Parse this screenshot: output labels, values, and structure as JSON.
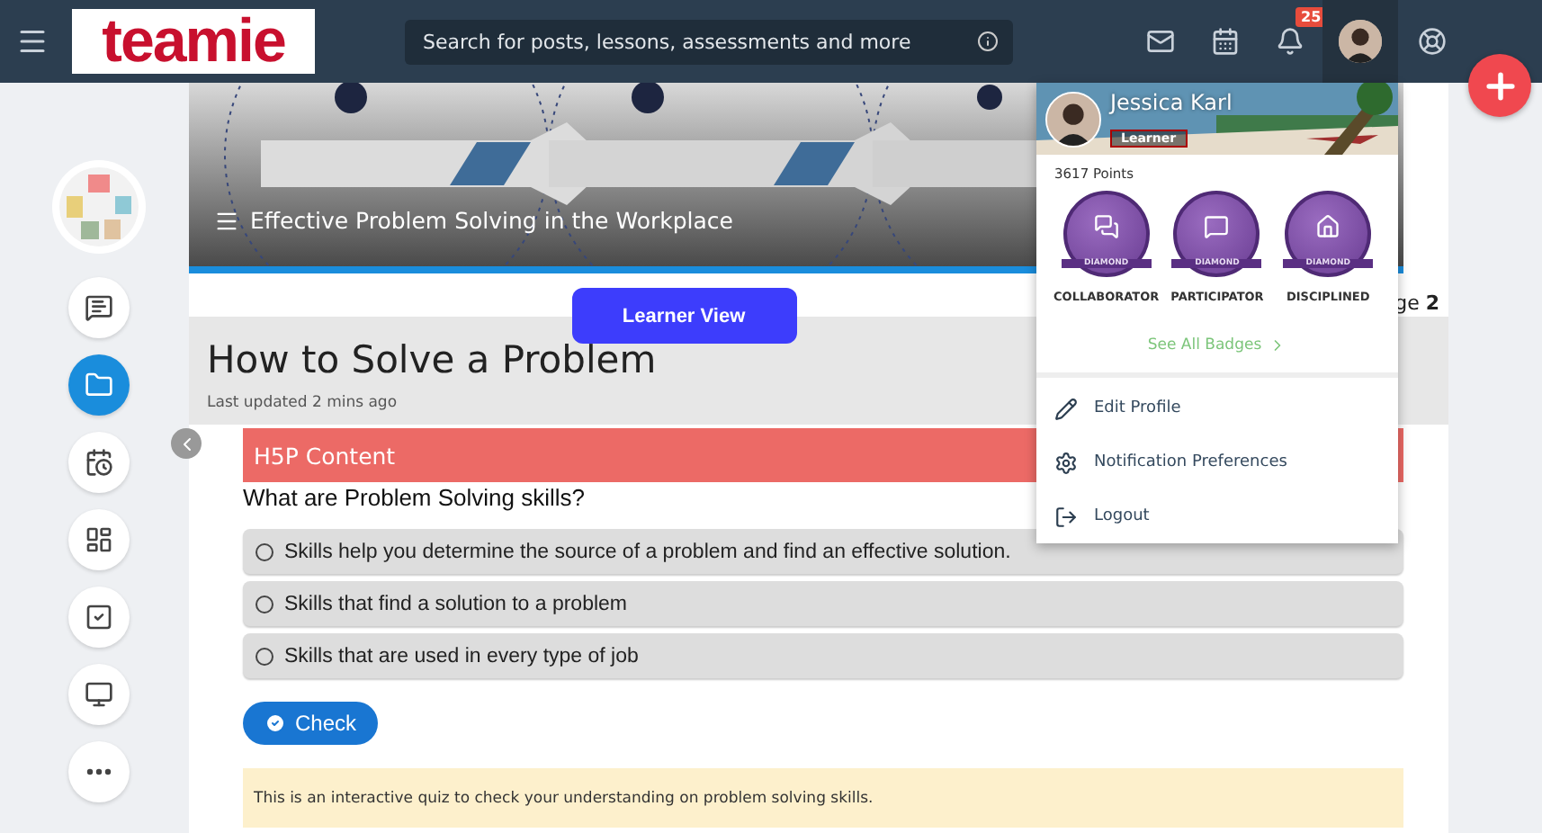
{
  "top_bar": {
    "logo": "teamie",
    "search": {
      "placeholder": "Search for posts, lessons, assessments and more"
    },
    "notification_count": "25"
  },
  "sidebar": {
    "items": [
      {
        "selected": false
      },
      {
        "selected": true
      },
      {
        "selected": false
      },
      {
        "selected": false
      },
      {
        "selected": false
      },
      {
        "selected": false
      },
      {
        "selected": false
      }
    ]
  },
  "banner": {
    "title": "Effective Problem Solving in the Workplace"
  },
  "page_indicator": {
    "prefix": "ge",
    "number": "2"
  },
  "learner_view_button": "Learner View",
  "lesson": {
    "title": "How to Solve a Problem",
    "updated": "Last updated 2 mins ago"
  },
  "h5p": {
    "header": "H5P Content",
    "question": "What are Problem Solving skills?",
    "options": [
      {
        "label": "Skills help you determine the source of a problem and find an effective solution.",
        "selected": false
      },
      {
        "label": "Skills that find a solution to a problem",
        "selected": false
      },
      {
        "label": "Skills that are used in every type of job",
        "selected": false
      }
    ],
    "check_button": "Check",
    "note": "This is an interactive quiz to check your understanding on problem solving skills."
  },
  "profile_menu": {
    "name": "Jessica Karl",
    "role": "Learner",
    "points": "3617 Points",
    "badges": [
      {
        "level": "DIAMOND",
        "name": "COLLABORATOR"
      },
      {
        "level": "DIAMOND",
        "name": "PARTICIPATOR"
      },
      {
        "level": "DIAMOND",
        "name": "DISCIPLINED"
      }
    ],
    "see_all": "See All Badges",
    "items": [
      "Edit Profile",
      "Notification Preferences",
      "Logout"
    ]
  }
}
